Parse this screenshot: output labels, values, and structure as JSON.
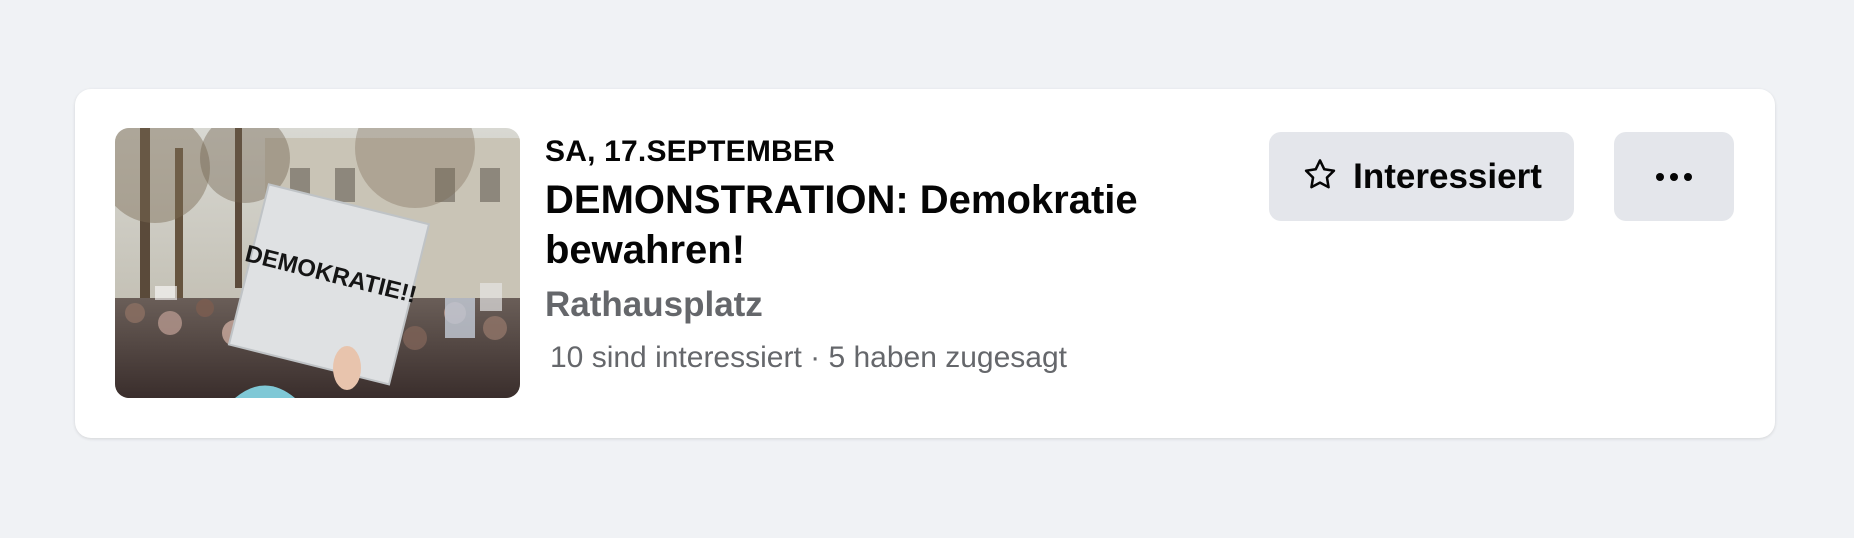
{
  "event": {
    "date": "SA, 17.SEPTEMBER",
    "title": "DEMONSTRATION: Demokratie bewahren!",
    "location": "Rathausplatz",
    "stats": "10 sind interessiert · 5 haben zugesagt",
    "sign_text": "DEMOKRATIE!!"
  },
  "actions": {
    "interested_label": "Interessiert",
    "interested_icon": "star-outline-icon",
    "more_icon": "more-dots-icon"
  },
  "colors": {
    "page_bg": "#f0f2f5",
    "button_bg": "#e4e6eb",
    "secondary_text": "#65676b"
  }
}
